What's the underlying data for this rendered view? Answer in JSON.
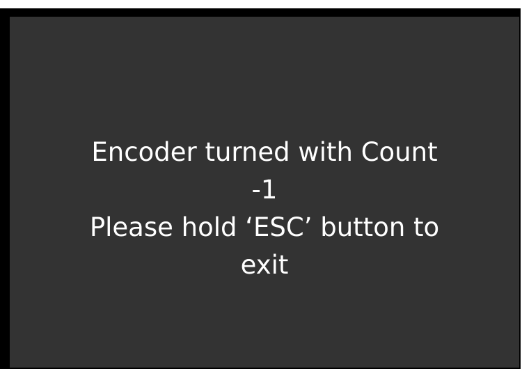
{
  "screen": {
    "lines": [
      "Encoder turned with Count",
      "-1",
      "Please hold ‘ESC’ button to",
      "exit"
    ]
  },
  "colors": {
    "background": "#333333",
    "text": "#ffffff",
    "frame": "#000000"
  }
}
